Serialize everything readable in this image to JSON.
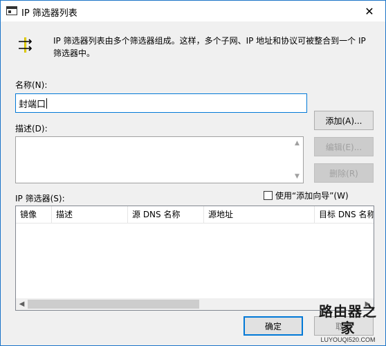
{
  "window": {
    "title": "IP 筛选器列表",
    "close_glyph": "✕"
  },
  "intro_text": "IP 筛选器列表由多个筛选器组成。这样，多个子网、IP 地址和协议可被整合到一个 IP 筛选器中。",
  "name": {
    "label": "名称(N):",
    "value": "封端口"
  },
  "description": {
    "label": "描述(D):",
    "value": ""
  },
  "buttons": {
    "add": "添加(A)...",
    "edit": "编辑(E)...",
    "remove": "删除(R)",
    "ok": "确定",
    "cancel": "取消"
  },
  "filters": {
    "label": "IP 筛选器(S):",
    "wizard_checkbox_label": "使用“添加向导”(W)",
    "wizard_checked": false,
    "columns": [
      "镜像",
      "描述",
      "源 DNS 名称",
      "源地址",
      "目标 DNS 名称"
    ],
    "rows": []
  },
  "scroll_glyphs": {
    "up": "▲",
    "down": "▼",
    "left": "◀",
    "right": "▶"
  },
  "watermark": {
    "title": "路由器之家",
    "url": "LUYOUQI520.COM"
  }
}
